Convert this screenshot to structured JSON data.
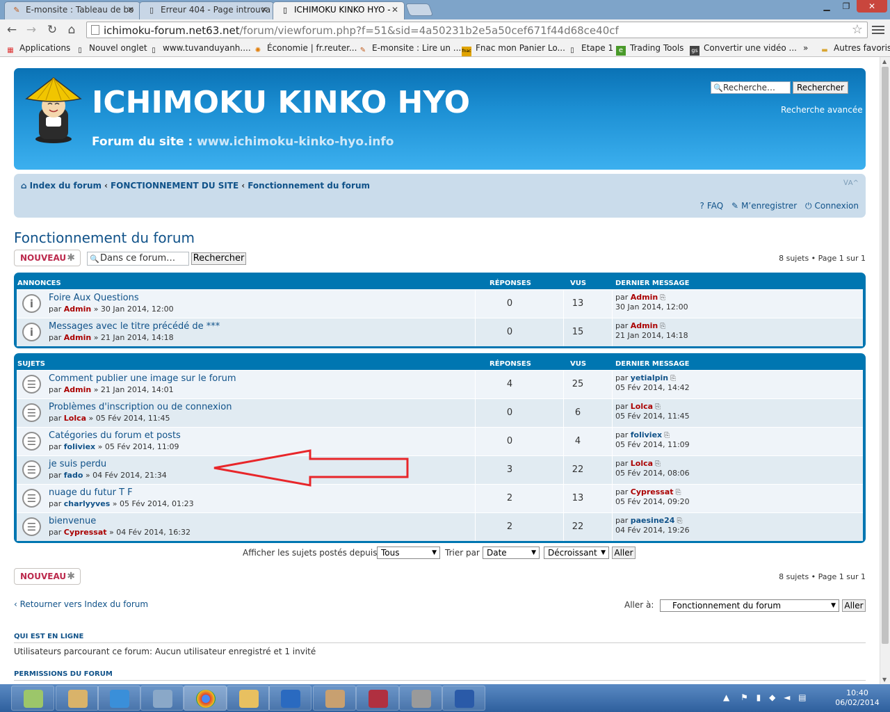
{
  "browser": {
    "tabs": [
      {
        "title": "E-monsite : Tableau de bo"
      },
      {
        "title": "Erreur 404 - Page introuva"
      },
      {
        "title": "ICHIMOKU KINKO HYO - "
      }
    ],
    "url_host": "ichimoku-forum.net63.net",
    "url_rest": "/forum/viewforum.php?f=51&sid=4a50231b2e5a50cef671f44d68ce40cf",
    "bookmarks": [
      "Applications",
      "Nouvel onglet",
      "www.tuvanduyanh....",
      "Économie | fr.reuter...",
      "E-monsite : Lire un ...",
      "Fnac mon Panier Lo...",
      "Etape 1",
      "Trading Tools",
      "Convertir une vidéo ...",
      "»",
      "Autres favoris"
    ]
  },
  "header": {
    "title": "ICHIMOKU KINKO HYO",
    "subtitle_prefix": "Forum du site : ",
    "subtitle_url": "www.ichimoku-kinko-hyo.info",
    "search_placeholder": "Recherche…",
    "search_button": "Rechercher",
    "advanced_search": "Recherche avancée"
  },
  "navbar": {
    "crumbs": [
      "Index du forum",
      "FONCTIONNEMENT DU SITE",
      "Fonctionnement du forum"
    ],
    "font_size": "ᐯA^",
    "faq": "FAQ",
    "register": "M’enregistrer",
    "login": "Connexion"
  },
  "forum": {
    "title": "Fonctionnement du forum",
    "new_button": "NOUVEAU",
    "search_placeholder": "Dans ce forum…",
    "search_button": "Rechercher",
    "pagination": "8 sujets • Page 1 sur 1"
  },
  "columns": {
    "replies": "RÉPONSES",
    "views": "VUS",
    "last": "DERNIER MESSAGE"
  },
  "announcements": {
    "header": "ANNONCES",
    "rows": [
      {
        "title": "Foire Aux Questions",
        "by": "par",
        "author": "Admin",
        "date": "» 30 Jan 2014, 12:00",
        "replies": "0",
        "views": "13",
        "last_by": "par",
        "last_author": "Admin",
        "last_date": "30 Jan 2014, 12:00"
      },
      {
        "title": "Messages avec le titre précédé de ***",
        "by": "par",
        "author": "Admin",
        "date": "» 21 Jan 2014, 14:18",
        "replies": "0",
        "views": "15",
        "last_by": "par",
        "last_author": "Admin",
        "last_date": "21 Jan 2014, 14:18"
      }
    ]
  },
  "topics": {
    "header": "SUJETS",
    "rows": [
      {
        "title": "Comment publier une image sur le forum",
        "by": "par",
        "author": "Admin",
        "date": "» 21 Jan 2014, 14:01",
        "replies": "4",
        "views": "25",
        "last_by": "par",
        "last_author": "yetialpin",
        "last_date": "05 Fév 2014, 14:42"
      },
      {
        "title": "Problèmes d'inscription ou de connexion",
        "by": "par",
        "author": "Lolca",
        "date": "» 05 Fév 2014, 11:45",
        "replies": "0",
        "views": "6",
        "last_by": "par",
        "last_author": "Lolca",
        "last_date": "05 Fév 2014, 11:45"
      },
      {
        "title": "Catégories du forum et posts",
        "by": "par",
        "author": "foliviex",
        "date": "» 05 Fév 2014, 11:09",
        "replies": "0",
        "views": "4",
        "last_by": "par",
        "last_author": "foliviex",
        "last_date": "05 Fév 2014, 11:09"
      },
      {
        "title": "je suis perdu",
        "by": "par",
        "author": "fado",
        "date": "» 04 Fév 2014, 21:34",
        "replies": "3",
        "views": "22",
        "last_by": "par",
        "last_author": "Lolca",
        "last_date": "05 Fév 2014, 08:06"
      },
      {
        "title": "nuage du futur T F",
        "by": "par",
        "author": "charlyyves",
        "date": "» 05 Fév 2014, 01:23",
        "replies": "2",
        "views": "13",
        "last_by": "par",
        "last_author": "Cypressat",
        "last_date": "05 Fév 2014, 09:20"
      },
      {
        "title": "bienvenue",
        "by": "par",
        "author": "Cypressat",
        "date": "» 04 Fév 2014, 16:32",
        "replies": "2",
        "views": "22",
        "last_by": "par",
        "last_author": "paesine24",
        "last_date": "04 Fév 2014, 19:26"
      }
    ]
  },
  "filter": {
    "label": "Afficher les sujets postés depuis:",
    "since": "Tous",
    "sort_label": "Trier par",
    "sort_by": "Date",
    "order": "Décroissant",
    "go": "Aller"
  },
  "footer": {
    "return_link": "Retourner vers Index du forum",
    "goto_label": "Aller à:",
    "goto_value": "Fonctionnement du forum",
    "goto_button": "Aller",
    "online_title": "QUI EST EN LIGNE",
    "online_text": "Utilisateurs parcourant ce forum: Aucun utilisateur enregistré et 1 invité",
    "permissions_title": "PERMISSIONS DU FORUM"
  },
  "taskbar": {
    "time": "10:40",
    "date": "06/02/2014"
  },
  "colors": {
    "header": "#1c8fd3",
    "box": "#0076b1",
    "link": "#105289",
    "user_red": "#aa0000",
    "new_button": "#bc2a4d",
    "arrow": "#e8262a"
  }
}
